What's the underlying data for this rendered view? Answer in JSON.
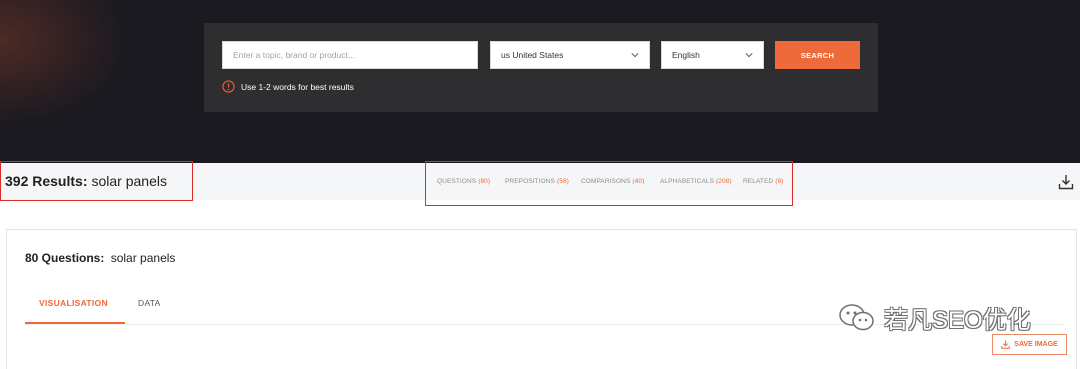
{
  "search": {
    "placeholder": "Enter a topic, brand or product...",
    "country": "us United States",
    "language": "English",
    "button_label": "SEARCH",
    "hint": "Use 1-2 words for best results"
  },
  "results": {
    "count_label": "392 Results:",
    "keyword": "solar panels",
    "categories": [
      {
        "label": "QUESTIONS",
        "count": "(80)"
      },
      {
        "label": "PREPOSITIONS",
        "count": "(56)"
      },
      {
        "label": "COMPARISONS",
        "count": "(40)"
      },
      {
        "label": "ALPHABETICALS",
        "count": "(208)"
      },
      {
        "label": "RELATED",
        "count": "(8)"
      }
    ]
  },
  "card": {
    "count_label": "80 Questions:",
    "keyword": "solar panels",
    "tabs": [
      "VISUALISATION",
      "DATA"
    ],
    "save_label": "SAVE IMAGE"
  },
  "watermark": {
    "text": "若凡SEO优化"
  },
  "colors": {
    "accent": "#ef6a3a",
    "highlight_box": "#e02b2b",
    "hero_bg": "#1b1a21",
    "panel_bg": "#2e2e30"
  }
}
